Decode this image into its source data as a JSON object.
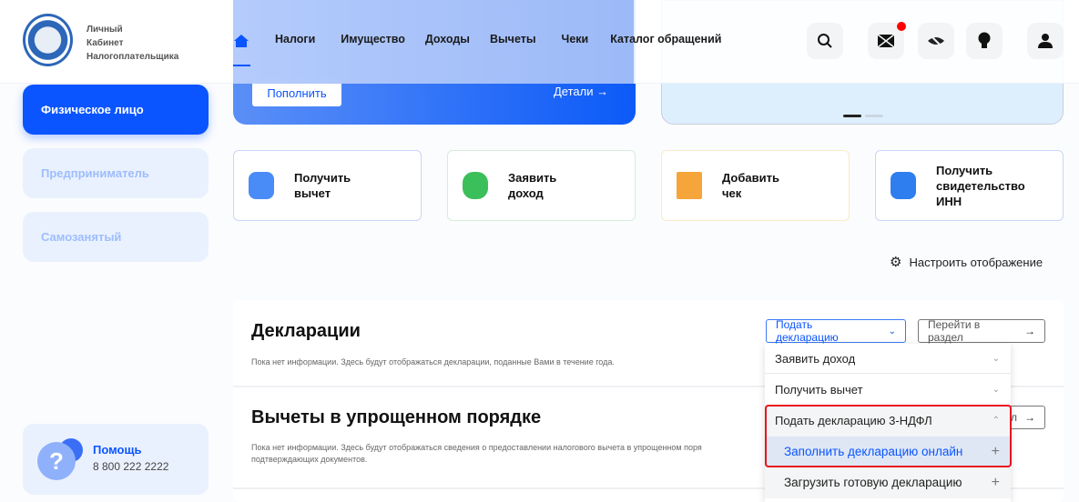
{
  "header": {
    "logo_text": [
      "Личный",
      "Кабинет",
      "Налогоплательщика"
    ],
    "nav": [
      "Налоги",
      "Имущество",
      "Доходы",
      "Вычеты",
      "Чеки",
      "Каталог обращений"
    ],
    "icons": [
      "search-icon",
      "mail-icon",
      "eye-off-icon",
      "lightbulb-icon",
      "user-icon"
    ],
    "accent": "#0a55ff",
    "notification_color": "#ff0000"
  },
  "balance_card": {
    "topup_label": "Пополнить",
    "details_label": "Детали"
  },
  "sidebar": {
    "items": [
      {
        "label": "Физическое лицо",
        "active": true
      },
      {
        "label": "Предприниматель"
      },
      {
        "label": "Самозанятый"
      }
    ],
    "help": {
      "title": "Помощь",
      "phone": "8 800 222 2222"
    }
  },
  "quick_actions": [
    {
      "label": "Получить вычет",
      "lines": [
        "Получить",
        "вычет"
      ],
      "color": "#4a8cf7"
    },
    {
      "label": "Заявить доход",
      "lines": [
        "Заявить",
        "доход"
      ],
      "color": "#3bbf5a"
    },
    {
      "label": "Добавить чек",
      "lines": [
        "Добавить",
        "чек"
      ],
      "color": "#f5a53a"
    },
    {
      "label": "Получить свидетельство ИНН",
      "lines": [
        "Получить",
        "свидетельство",
        "ИНН"
      ],
      "color": "#2f7ef0"
    }
  ],
  "customize_label": "Настроить отображение",
  "declarations": {
    "title": "Декларации",
    "text": "Пока нет информации. Здесь будут отображаться декларации, поданные Вами в течение года.",
    "submit_label": "Подать декларацию",
    "goto_label": "Перейти в раздел"
  },
  "simplified": {
    "title": "Вычеты в упрощенном порядке",
    "text1": "Пока нет информации. Здесь будут отображаться сведения о предоставлении налогового вычета в упрощенном поря",
    "text2": "подтверждающих документов.",
    "goto_label": "л"
  },
  "dropdown": {
    "items": [
      "Заявить доход",
      "Получить вычет",
      "Подать декларацию 3-НДФЛ"
    ],
    "sub_items": [
      "Заполнить декларацию онлайн",
      "Загрузить готовую декларацию"
    ]
  }
}
